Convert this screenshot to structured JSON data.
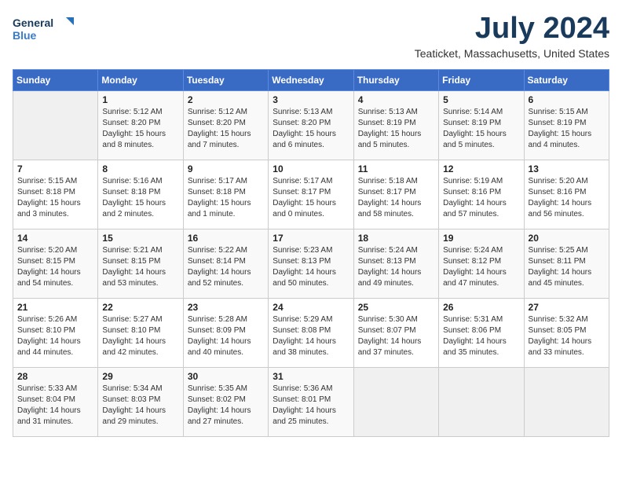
{
  "logo": {
    "line1": "General",
    "line2": "Blue"
  },
  "title": "July 2024",
  "location": "Teaticket, Massachusetts, United States",
  "days_header": [
    "Sunday",
    "Monday",
    "Tuesday",
    "Wednesday",
    "Thursday",
    "Friday",
    "Saturday"
  ],
  "weeks": [
    [
      {
        "day": "",
        "info": ""
      },
      {
        "day": "1",
        "info": "Sunrise: 5:12 AM\nSunset: 8:20 PM\nDaylight: 15 hours\nand 8 minutes."
      },
      {
        "day": "2",
        "info": "Sunrise: 5:12 AM\nSunset: 8:20 PM\nDaylight: 15 hours\nand 7 minutes."
      },
      {
        "day": "3",
        "info": "Sunrise: 5:13 AM\nSunset: 8:20 PM\nDaylight: 15 hours\nand 6 minutes."
      },
      {
        "day": "4",
        "info": "Sunrise: 5:13 AM\nSunset: 8:19 PM\nDaylight: 15 hours\nand 5 minutes."
      },
      {
        "day": "5",
        "info": "Sunrise: 5:14 AM\nSunset: 8:19 PM\nDaylight: 15 hours\nand 5 minutes."
      },
      {
        "day": "6",
        "info": "Sunrise: 5:15 AM\nSunset: 8:19 PM\nDaylight: 15 hours\nand 4 minutes."
      }
    ],
    [
      {
        "day": "7",
        "info": "Sunrise: 5:15 AM\nSunset: 8:18 PM\nDaylight: 15 hours\nand 3 minutes."
      },
      {
        "day": "8",
        "info": "Sunrise: 5:16 AM\nSunset: 8:18 PM\nDaylight: 15 hours\nand 2 minutes."
      },
      {
        "day": "9",
        "info": "Sunrise: 5:17 AM\nSunset: 8:18 PM\nDaylight: 15 hours\nand 1 minute."
      },
      {
        "day": "10",
        "info": "Sunrise: 5:17 AM\nSunset: 8:17 PM\nDaylight: 15 hours\nand 0 minutes."
      },
      {
        "day": "11",
        "info": "Sunrise: 5:18 AM\nSunset: 8:17 PM\nDaylight: 14 hours\nand 58 minutes."
      },
      {
        "day": "12",
        "info": "Sunrise: 5:19 AM\nSunset: 8:16 PM\nDaylight: 14 hours\nand 57 minutes."
      },
      {
        "day": "13",
        "info": "Sunrise: 5:20 AM\nSunset: 8:16 PM\nDaylight: 14 hours\nand 56 minutes."
      }
    ],
    [
      {
        "day": "14",
        "info": "Sunrise: 5:20 AM\nSunset: 8:15 PM\nDaylight: 14 hours\nand 54 minutes."
      },
      {
        "day": "15",
        "info": "Sunrise: 5:21 AM\nSunset: 8:15 PM\nDaylight: 14 hours\nand 53 minutes."
      },
      {
        "day": "16",
        "info": "Sunrise: 5:22 AM\nSunset: 8:14 PM\nDaylight: 14 hours\nand 52 minutes."
      },
      {
        "day": "17",
        "info": "Sunrise: 5:23 AM\nSunset: 8:13 PM\nDaylight: 14 hours\nand 50 minutes."
      },
      {
        "day": "18",
        "info": "Sunrise: 5:24 AM\nSunset: 8:13 PM\nDaylight: 14 hours\nand 49 minutes."
      },
      {
        "day": "19",
        "info": "Sunrise: 5:24 AM\nSunset: 8:12 PM\nDaylight: 14 hours\nand 47 minutes."
      },
      {
        "day": "20",
        "info": "Sunrise: 5:25 AM\nSunset: 8:11 PM\nDaylight: 14 hours\nand 45 minutes."
      }
    ],
    [
      {
        "day": "21",
        "info": "Sunrise: 5:26 AM\nSunset: 8:10 PM\nDaylight: 14 hours\nand 44 minutes."
      },
      {
        "day": "22",
        "info": "Sunrise: 5:27 AM\nSunset: 8:10 PM\nDaylight: 14 hours\nand 42 minutes."
      },
      {
        "day": "23",
        "info": "Sunrise: 5:28 AM\nSunset: 8:09 PM\nDaylight: 14 hours\nand 40 minutes."
      },
      {
        "day": "24",
        "info": "Sunrise: 5:29 AM\nSunset: 8:08 PM\nDaylight: 14 hours\nand 38 minutes."
      },
      {
        "day": "25",
        "info": "Sunrise: 5:30 AM\nSunset: 8:07 PM\nDaylight: 14 hours\nand 37 minutes."
      },
      {
        "day": "26",
        "info": "Sunrise: 5:31 AM\nSunset: 8:06 PM\nDaylight: 14 hours\nand 35 minutes."
      },
      {
        "day": "27",
        "info": "Sunrise: 5:32 AM\nSunset: 8:05 PM\nDaylight: 14 hours\nand 33 minutes."
      }
    ],
    [
      {
        "day": "28",
        "info": "Sunrise: 5:33 AM\nSunset: 8:04 PM\nDaylight: 14 hours\nand 31 minutes."
      },
      {
        "day": "29",
        "info": "Sunrise: 5:34 AM\nSunset: 8:03 PM\nDaylight: 14 hours\nand 29 minutes."
      },
      {
        "day": "30",
        "info": "Sunrise: 5:35 AM\nSunset: 8:02 PM\nDaylight: 14 hours\nand 27 minutes."
      },
      {
        "day": "31",
        "info": "Sunrise: 5:36 AM\nSunset: 8:01 PM\nDaylight: 14 hours\nand 25 minutes."
      },
      {
        "day": "",
        "info": ""
      },
      {
        "day": "",
        "info": ""
      },
      {
        "day": "",
        "info": ""
      }
    ]
  ]
}
